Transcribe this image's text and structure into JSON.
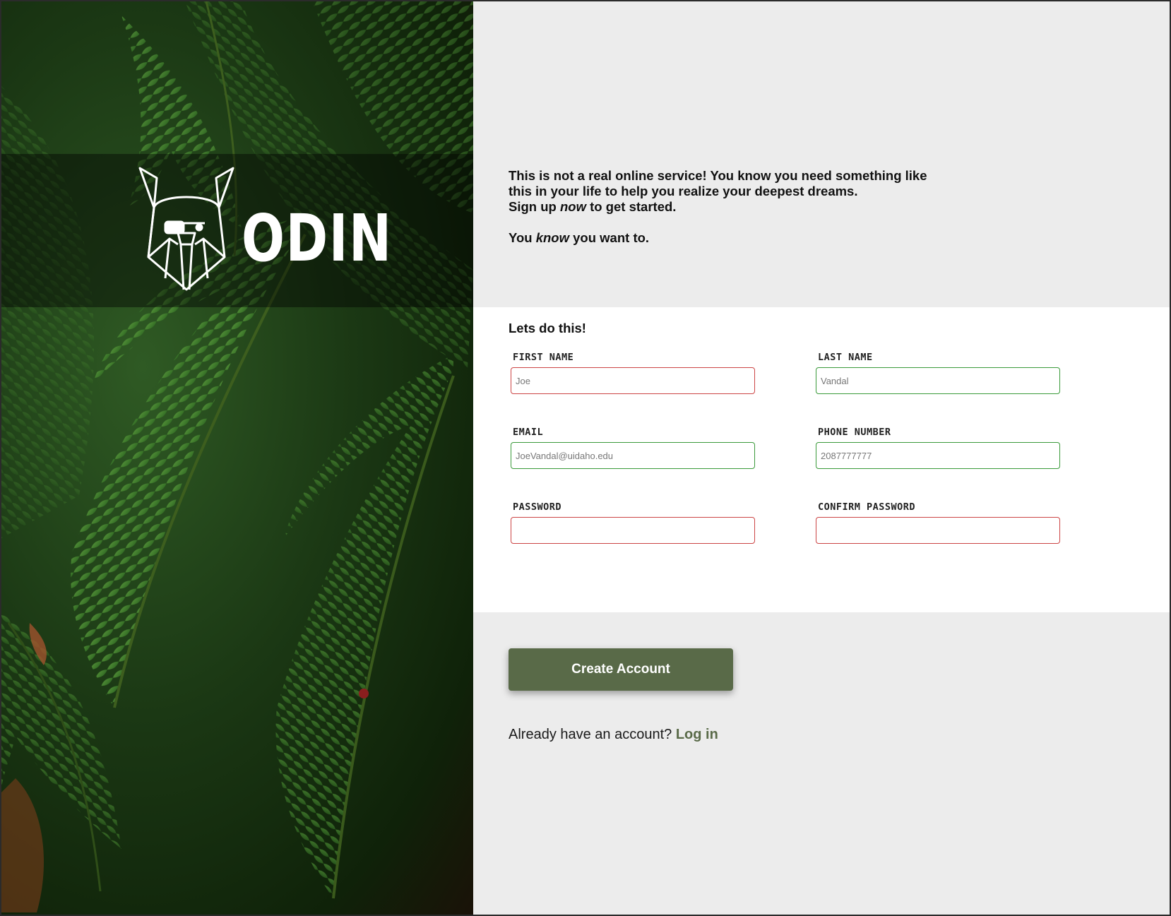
{
  "brand": {
    "name": "ODIN",
    "logo_icon": "viking-helmet-icon"
  },
  "intro": {
    "line1": "This is not a real online service! You know you need something like this in your life to help you realize your deepest dreams.",
    "line2_pre": "Sign up ",
    "line2_em": "now",
    "line2_post": " to get started.",
    "line3_pre": "You ",
    "line3_em": "know",
    "line3_post": " you want to."
  },
  "form": {
    "heading": "Lets do this!",
    "first_name": {
      "label": "FIRST NAME",
      "placeholder": "Joe",
      "state": "invalid"
    },
    "last_name": {
      "label": "LAST NAME",
      "placeholder": "Vandal",
      "state": "valid"
    },
    "email": {
      "label": "EMAIL",
      "placeholder": "JoeVandal@uidaho.edu",
      "state": "valid"
    },
    "phone": {
      "label": "PHONE NUMBER",
      "placeholder": "2087777777",
      "state": "valid"
    },
    "password": {
      "label": "PASSWORD",
      "placeholder": "",
      "state": "invalid"
    },
    "confirm_password": {
      "label": "CONFIRM PASSWORD",
      "placeholder": "",
      "state": "invalid"
    }
  },
  "actions": {
    "create_account": "Create Account",
    "login_prompt": "Already have an account?",
    "login_link": "Log in"
  },
  "colors": {
    "accent": "#596a48",
    "valid": "#3a9a3a",
    "invalid": "#cc4444",
    "panel_bg": "#ececec"
  }
}
